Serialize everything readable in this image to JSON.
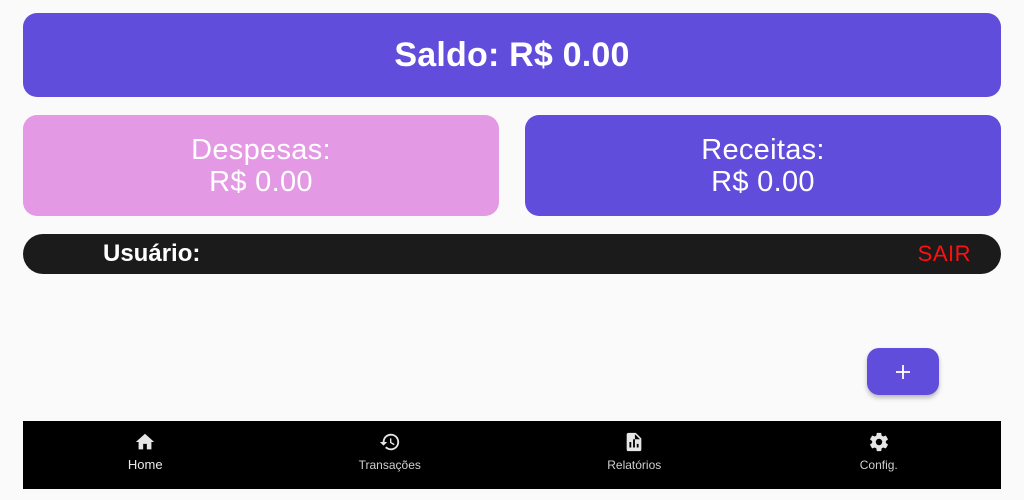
{
  "balance": {
    "text": "Saldo: R$ 0.00"
  },
  "expenses": {
    "label": "Despesas:",
    "value": "R$ 0.00"
  },
  "income": {
    "label": "Receitas:",
    "value": "R$ 0.00"
  },
  "user_bar": {
    "label": "Usuário:",
    "logout": "SAIR"
  },
  "fab": {
    "icon": "plus-icon"
  },
  "nav": {
    "active": "Home",
    "items": [
      {
        "label": "Home",
        "icon": "home-icon"
      },
      {
        "label": "Transações",
        "icon": "history-icon"
      },
      {
        "label": "Relatórios",
        "icon": "report-icon"
      },
      {
        "label": "Config.",
        "icon": "gear-icon"
      }
    ]
  },
  "colors": {
    "primary": "#614ddc",
    "expense_card": "#e499e4",
    "user_bar": "#1b1b1b",
    "logout": "#ff0f0f",
    "nav_background": "#000000"
  }
}
